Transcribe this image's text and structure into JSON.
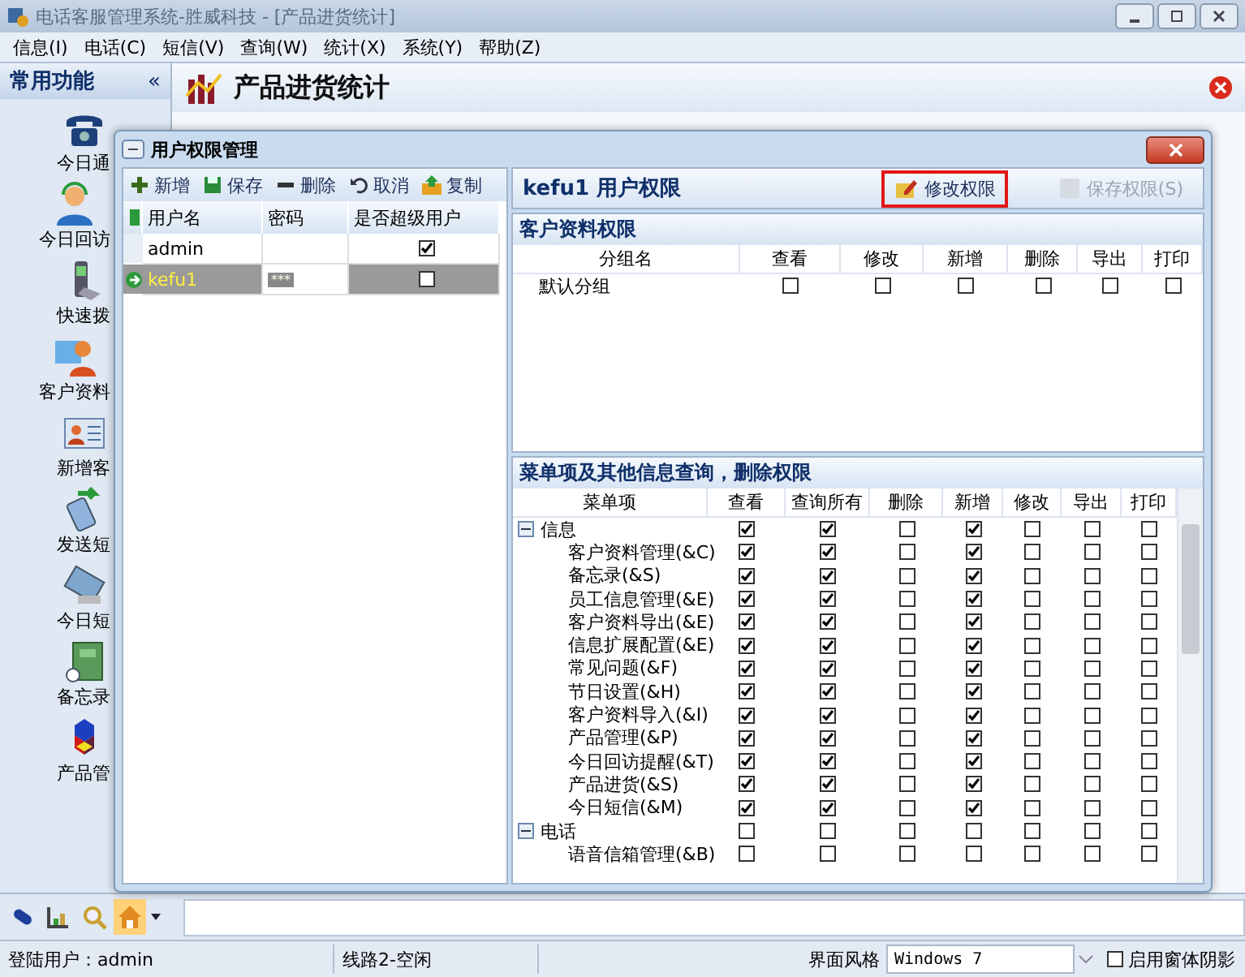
{
  "app": {
    "title": "电话客服管理系统-胜威科技 - [产品进货统计]"
  },
  "menu": [
    "信息(I)",
    "电话(C)",
    "短信(V)",
    "查询(W)",
    "统计(X)",
    "系统(Y)",
    "帮助(Z)"
  ],
  "sidebar": {
    "title": "常用功能",
    "collapse": "«",
    "items": [
      {
        "label": "今日通",
        "kind": "phone"
      },
      {
        "label": "今日回访",
        "kind": "person"
      },
      {
        "label": "快速拨",
        "kind": "handset"
      },
      {
        "label": "客户资料",
        "kind": "customer"
      },
      {
        "label": "新增客",
        "kind": "card"
      },
      {
        "label": "发送短",
        "kind": "send"
      },
      {
        "label": "今日短",
        "kind": "mobile"
      },
      {
        "label": "备忘录",
        "kind": "memo"
      },
      {
        "label": "产品管",
        "kind": "product"
      }
    ]
  },
  "page": {
    "title": "产品进货统计"
  },
  "dialog": {
    "title": "用户权限管理",
    "toolbar": [
      {
        "label": "新增",
        "kind": "add"
      },
      {
        "label": "保存",
        "kind": "save"
      },
      {
        "label": "删除",
        "kind": "delete"
      },
      {
        "label": "取消",
        "kind": "undo"
      },
      {
        "label": "复制",
        "kind": "copy"
      }
    ],
    "users": {
      "columns": [
        "用户名",
        "密码",
        "是否超级用户"
      ],
      "rows": [
        {
          "name": "admin",
          "password": "",
          "super": true,
          "selected": false
        },
        {
          "name": "kefu1",
          "password": "***",
          "super": false,
          "selected": true
        }
      ]
    },
    "heading": "kefu1 用户权限",
    "edit_button": {
      "label": "修改权限",
      "highlighted": true
    },
    "save_button": {
      "label": "保存权限(S)",
      "disabled": true
    },
    "customer_perms": {
      "title": "客户资料权限",
      "columns": [
        "分组名",
        "查看",
        "修改",
        "新增",
        "删除",
        "导出",
        "打印"
      ],
      "rows": [
        {
          "label": "默认分组",
          "checks": [
            false,
            false,
            false,
            false,
            false,
            false
          ]
        }
      ]
    },
    "menu_perms": {
      "title": "菜单项及其他信息查询，删除权限",
      "columns": [
        "菜单项",
        "查看",
        "查询所有",
        "删除",
        "新增",
        "修改",
        "导出",
        "打印"
      ],
      "rows": [
        {
          "label": "信息",
          "expanded": true,
          "checks": [
            true,
            true,
            false,
            true,
            false,
            false,
            false
          ],
          "children": [
            {
              "label": "客户资料管理(&C)",
              "checks": [
                true,
                true,
                false,
                true,
                false,
                false,
                false
              ]
            },
            {
              "label": "备忘录(&S)",
              "checks": [
                true,
                true,
                false,
                true,
                false,
                false,
                false
              ]
            },
            {
              "label": "员工信息管理(&E)",
              "checks": [
                true,
                true,
                false,
                true,
                false,
                false,
                false
              ]
            },
            {
              "label": "客户资料导出(&E)",
              "checks": [
                true,
                true,
                false,
                true,
                false,
                false,
                false
              ]
            },
            {
              "label": "信息扩展配置(&E)",
              "checks": [
                true,
                true,
                false,
                true,
                false,
                false,
                false
              ]
            },
            {
              "label": "常见问题(&F)",
              "checks": [
                true,
                true,
                false,
                true,
                false,
                false,
                false
              ]
            },
            {
              "label": "节日设置(&H)",
              "checks": [
                true,
                true,
                false,
                true,
                false,
                false,
                false
              ]
            },
            {
              "label": "客户资料导入(&I)",
              "checks": [
                true,
                true,
                false,
                true,
                false,
                false,
                false
              ]
            },
            {
              "label": "产品管理(&P)",
              "checks": [
                true,
                true,
                false,
                true,
                false,
                false,
                false
              ]
            },
            {
              "label": "今日回访提醒(&T)",
              "checks": [
                true,
                true,
                false,
                true,
                false,
                false,
                false
              ]
            },
            {
              "label": "产品进货(&S)",
              "checks": [
                true,
                true,
                false,
                true,
                false,
                false,
                false
              ]
            },
            {
              "label": "今日短信(&M)",
              "checks": [
                true,
                true,
                false,
                true,
                false,
                false,
                false
              ]
            }
          ]
        },
        {
          "label": "电话",
          "expanded": true,
          "checks": [
            false,
            false,
            false,
            false,
            false,
            false,
            false
          ],
          "children": [
            {
              "label": "语音信箱管理(&B)",
              "checks": [
                false,
                false,
                false,
                false,
                false,
                false,
                false
              ]
            }
          ]
        }
      ]
    }
  },
  "bottom_toolbar": [
    {
      "kind": "phone",
      "selected": false
    },
    {
      "kind": "chart",
      "selected": false
    },
    {
      "kind": "search",
      "selected": false
    },
    {
      "kind": "home",
      "selected": true
    }
  ],
  "status": {
    "user": "登陆用户：admin",
    "line": "线路2-空闲",
    "theme_label": "界面风格",
    "theme": "Windows 7",
    "shadow": {
      "label": "启用窗体阴影",
      "checked": false
    }
  }
}
